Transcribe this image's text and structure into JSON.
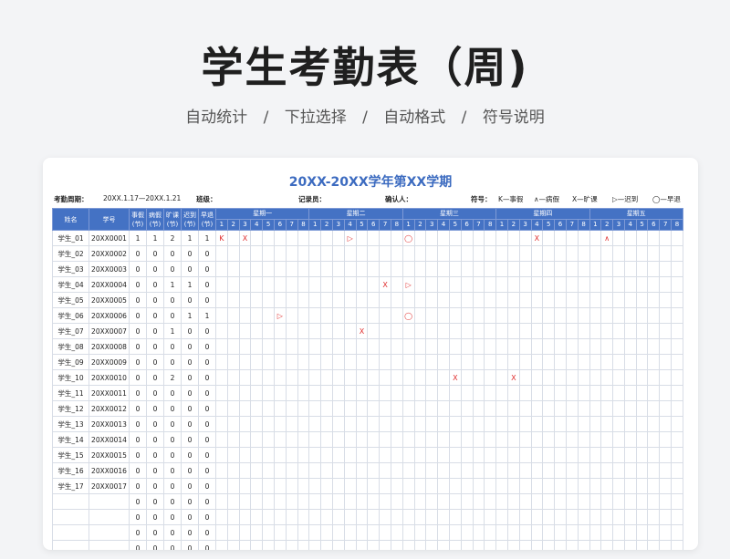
{
  "hero": {
    "title": "学生考勤表（周)",
    "subtitle": [
      "自动统计",
      "/",
      "下拉选择",
      "/",
      "自动格式",
      "/",
      "符号说明"
    ]
  },
  "sheet": {
    "title": "20XX-20XX学年第XX学期",
    "period_label": "考勤周期：",
    "period_value": "20XX.1.17—20XX.1.21",
    "class_label": "班级：",
    "recorder_label": "记录员：",
    "confirmer_label": "确认人：",
    "symbols_label": "符号：",
    "legend": [
      "K—事假",
      "∧—病假",
      "X—旷课",
      "▷—迟到",
      "◯—早退"
    ]
  },
  "headers": {
    "name": "姓名",
    "id": "学号",
    "stats": [
      "事假(节)",
      "病假(节)",
      "旷课(节)",
      "迟到(节)",
      "早退(节)"
    ],
    "days": [
      "星期一",
      "星期二",
      "星期三",
      "星期四",
      "星期五"
    ],
    "periods": [
      "1",
      "2",
      "3",
      "4",
      "5",
      "6",
      "7",
      "8"
    ]
  },
  "rows": [
    {
      "name": "学生_01",
      "id": "20XX0001",
      "stats": [
        "1",
        "1",
        "2",
        "1",
        "1"
      ],
      "marks": {
        "0": "K",
        "2": "X",
        "11": "▷",
        "16": "◯",
        "27": "X",
        "33": "∧"
      }
    },
    {
      "name": "学生_02",
      "id": "20XX0002",
      "stats": [
        "0",
        "0",
        "0",
        "0",
        "0"
      ],
      "marks": {}
    },
    {
      "name": "学生_03",
      "id": "20XX0003",
      "stats": [
        "0",
        "0",
        "0",
        "0",
        "0"
      ],
      "marks": {}
    },
    {
      "name": "学生_04",
      "id": "20XX0004",
      "stats": [
        "0",
        "0",
        "1",
        "1",
        "0"
      ],
      "marks": {
        "14": "X",
        "16": "▷"
      }
    },
    {
      "name": "学生_05",
      "id": "20XX0005",
      "stats": [
        "0",
        "0",
        "0",
        "0",
        "0"
      ],
      "marks": {}
    },
    {
      "name": "学生_06",
      "id": "20XX0006",
      "stats": [
        "0",
        "0",
        "0",
        "1",
        "1"
      ],
      "marks": {
        "5": "▷",
        "16": "◯"
      }
    },
    {
      "name": "学生_07",
      "id": "20XX0007",
      "stats": [
        "0",
        "0",
        "1",
        "0",
        "0"
      ],
      "marks": {
        "12": "X"
      }
    },
    {
      "name": "学生_08",
      "id": "20XX0008",
      "stats": [
        "0",
        "0",
        "0",
        "0",
        "0"
      ],
      "marks": {}
    },
    {
      "name": "学生_09",
      "id": "20XX0009",
      "stats": [
        "0",
        "0",
        "0",
        "0",
        "0"
      ],
      "marks": {}
    },
    {
      "name": "学生_10",
      "id": "20XX0010",
      "stats": [
        "0",
        "0",
        "2",
        "0",
        "0"
      ],
      "marks": {
        "20": "X",
        "25": "X"
      }
    },
    {
      "name": "学生_11",
      "id": "20XX0011",
      "stats": [
        "0",
        "0",
        "0",
        "0",
        "0"
      ],
      "marks": {}
    },
    {
      "name": "学生_12",
      "id": "20XX0012",
      "stats": [
        "0",
        "0",
        "0",
        "0",
        "0"
      ],
      "marks": {}
    },
    {
      "name": "学生_13",
      "id": "20XX0013",
      "stats": [
        "0",
        "0",
        "0",
        "0",
        "0"
      ],
      "marks": {}
    },
    {
      "name": "学生_14",
      "id": "20XX0014",
      "stats": [
        "0",
        "0",
        "0",
        "0",
        "0"
      ],
      "marks": {}
    },
    {
      "name": "学生_15",
      "id": "20XX0015",
      "stats": [
        "0",
        "0",
        "0",
        "0",
        "0"
      ],
      "marks": {}
    },
    {
      "name": "学生_16",
      "id": "20XX0016",
      "stats": [
        "0",
        "0",
        "0",
        "0",
        "0"
      ],
      "marks": {}
    },
    {
      "name": "学生_17",
      "id": "20XX0017",
      "stats": [
        "0",
        "0",
        "0",
        "0",
        "0"
      ],
      "marks": {}
    },
    {
      "name": "",
      "id": "",
      "stats": [
        "0",
        "0",
        "0",
        "0",
        "0"
      ],
      "marks": {}
    },
    {
      "name": "",
      "id": "",
      "stats": [
        "0",
        "0",
        "0",
        "0",
        "0"
      ],
      "marks": {}
    },
    {
      "name": "",
      "id": "",
      "stats": [
        "0",
        "0",
        "0",
        "0",
        "0"
      ],
      "marks": {}
    },
    {
      "name": "",
      "id": "",
      "stats": [
        "0",
        "0",
        "0",
        "0",
        "0"
      ],
      "marks": {}
    }
  ]
}
